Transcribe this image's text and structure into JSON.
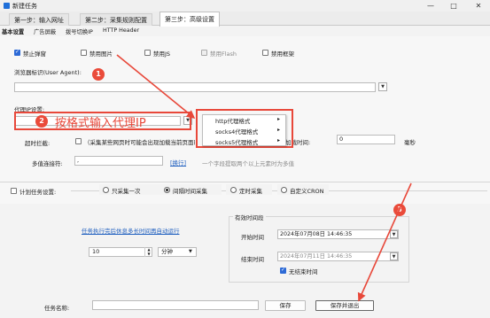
{
  "window": {
    "title": "新建任务",
    "minimize": "—",
    "maximize": "□",
    "close": "✕"
  },
  "tabs": [
    {
      "label": "第一步：输入网址"
    },
    {
      "label": "第二步：采集规则配置"
    },
    {
      "label": "第三步：高级设置"
    }
  ],
  "subtabs": [
    {
      "label": "基本设置"
    },
    {
      "label": "广告屏蔽"
    },
    {
      "label": "拨号切换IP"
    },
    {
      "label": "HTTP Header"
    }
  ],
  "options": {
    "disable_popup": "禁止弹窗",
    "disable_images": "禁用图片",
    "disable_js": "禁用JS",
    "disable_flash": "禁用Flash",
    "disable_frames": "禁用框架"
  },
  "user_agent": {
    "label": "浏览器标识(User Agent):",
    "value": ""
  },
  "proxy": {
    "label": "代理IP设置:",
    "annotation": "按格式输入代理IP",
    "menu": [
      {
        "label": "http代理格式"
      },
      {
        "label": "socks4代理格式"
      },
      {
        "label": "socks5代理格式"
      }
    ]
  },
  "timeout": {
    "label": "超时拦截:",
    "checkbox_label": "（采集某些网页时可能会出现加载当前页面时会自动跳转到",
    "right_label": "加载时间:",
    "value": "0",
    "unit": "毫秒"
  },
  "multi_value": {
    "label": "多值连接符:",
    "value": ",",
    "link": "[换行]",
    "hint": "一个字段提取两个以上元素时为多值"
  },
  "schedule": {
    "checkbox_label": "计划任务设置:",
    "radios": [
      {
        "label": "只采集一次"
      },
      {
        "label": "间隔时间采集"
      },
      {
        "label": "定时采集"
      },
      {
        "label": "自定义CRON"
      }
    ],
    "restart_label": "任务执行完后休息多长时间再自动运行",
    "interval_value": "10",
    "interval_unit": "分钟",
    "period_title": "有效时间段",
    "start_label": "开始时间",
    "start_value": "2024年07月08日  14:46:35",
    "end_label": "结束时间",
    "end_value": "2024年07月11日  14:46:35",
    "unlimited_label": "无结束时间"
  },
  "footer": {
    "task_name_label": "任务名称:",
    "task_name_value": "",
    "save": "保存",
    "save_exit": "保存并退出"
  },
  "annotations": {
    "badge1": "1",
    "badge2": "2",
    "badge3": "3"
  },
  "colors": {
    "accent": "#2d6ad6",
    "annotation_red": "#e8483a",
    "link": "#1f5fbf"
  }
}
